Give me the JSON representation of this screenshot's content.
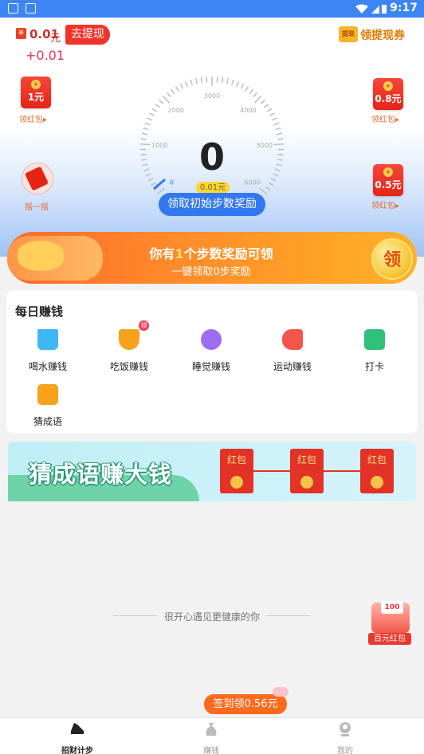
{
  "status_bar": {
    "time": "9:17"
  },
  "header": {
    "coin_icon": "yuan-coin-icon",
    "balance": "0.01",
    "balance_unit": "元",
    "withdraw_label": "去提现",
    "balance_delta": "+0.01",
    "coupon_badge": "提现",
    "coupon_label": "领提现券"
  },
  "red_packets": [
    {
      "amount": "1元",
      "label": "领红包"
    },
    {
      "amount": "0.8元",
      "label": "领红包"
    },
    {
      "amount": "0.5元",
      "label": "领红包"
    }
  ],
  "shake": {
    "label": "摇一摇"
  },
  "gauge": {
    "ticks": [
      "0",
      "1000",
      "2000",
      "3000",
      "4000",
      "5000",
      "6000"
    ],
    "steps": "0",
    "reward": "0.01元",
    "claim_label": "领取初始步数奖励"
  },
  "banner": {
    "title_pre": "你有",
    "title_num": "1",
    "title_post": "个步数奖励可领",
    "subtitle": "一键领取0步奖励",
    "button": "领"
  },
  "daily": {
    "title": "每日赚钱",
    "badge": "领",
    "tasks": [
      {
        "label": "喝水赚钱",
        "icon": "water-cup-icon",
        "color": "#3fb6f5"
      },
      {
        "label": "吃饭赚钱",
        "icon": "food-bowl-icon",
        "color": "#f7a21b"
      },
      {
        "label": "睡觉赚钱",
        "icon": "moon-icon",
        "color": "#9b6ef3"
      },
      {
        "label": "运动赚钱",
        "icon": "sneaker-icon",
        "color": "#f2564a"
      },
      {
        "label": "打卡",
        "icon": "calendar-check-icon",
        "color": "#2fc07a"
      },
      {
        "label": "猜成语",
        "icon": "idiom-book-icon",
        "color": "#f7a21b"
      }
    ]
  },
  "idiom_banner": {
    "title": "猜成语赚大钱",
    "envelopes": [
      "红包",
      "红包",
      "红包"
    ]
  },
  "footer": {
    "tagline": "很开心遇见更健康的你",
    "hundred_badge": "100",
    "hundred_label": "百元红包",
    "checkin_label": "签到领0.56元"
  },
  "tabs": [
    {
      "label": "招财计步",
      "icon": "shoe-icon",
      "active": true
    },
    {
      "label": "赚钱",
      "icon": "money-bag-icon",
      "active": false
    },
    {
      "label": "我的",
      "icon": "profile-icon",
      "active": false
    }
  ]
}
